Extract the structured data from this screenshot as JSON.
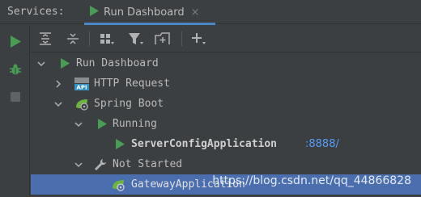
{
  "window": {
    "title": "Services:"
  },
  "tab": {
    "label": "Run Dashboard",
    "close_icon": "×"
  },
  "side_toolbar": [
    {
      "name": "run-icon"
    },
    {
      "name": "debug-icon"
    },
    {
      "name": "stop-icon"
    }
  ],
  "toolbar": [
    {
      "name": "expand-all-icon"
    },
    {
      "name": "collapse-all-icon"
    },
    {
      "name": "group-by-icon"
    },
    {
      "name": "filter-icon"
    },
    {
      "name": "new-tab-icon"
    },
    {
      "name": "add-icon"
    }
  ],
  "tree": {
    "root": "Run Dashboard",
    "http_request": "HTTP Request",
    "spring_boot": "Spring Boot",
    "running": "Running",
    "server_app": "ServerConfigApplication",
    "server_port": ":8888/",
    "not_started": "Not Started",
    "gateway_app": "GatewayApplication"
  },
  "colors": {
    "accent": "#4a88c7",
    "run_green": "#499c54",
    "selection": "#4b6eaf",
    "port_link": "#589df6"
  },
  "watermark": "https://blog.csdn.net/qq_44866828"
}
